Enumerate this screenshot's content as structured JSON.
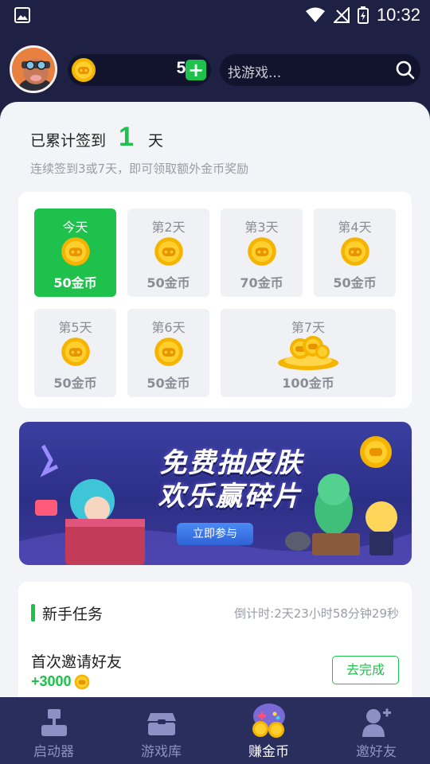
{
  "status_bar": {
    "time": "10:32"
  },
  "header": {
    "coin_count": "50",
    "add_symbol": "+",
    "search_placeholder": "找游戏..."
  },
  "checkin": {
    "title_prefix": "已累计签到",
    "days_count": "1",
    "title_suffix": "天",
    "subtitle": "连续签到3或7天，即可领取额外金币奖励",
    "days": [
      {
        "label": "今天",
        "reward": "50金币",
        "active": true
      },
      {
        "label": "第2天",
        "reward": "50金币"
      },
      {
        "label": "第3天",
        "reward": "70金币"
      },
      {
        "label": "第4天",
        "reward": "50金币"
      },
      {
        "label": "第5天",
        "reward": "50金币"
      },
      {
        "label": "第6天",
        "reward": "50金币"
      },
      {
        "label": "第7天",
        "reward": "100金币"
      }
    ]
  },
  "banner": {
    "line1": "免费抽皮肤",
    "line2": "欢乐赢碎片",
    "button": "立即参与"
  },
  "tasks": {
    "title": "新手任务",
    "countdown": "倒计时:2天23小时58分钟29秒",
    "items": [
      {
        "name": "首次邀请好友",
        "reward": "+3000",
        "button": "去完成"
      }
    ]
  },
  "bottom_nav": [
    {
      "label": "启动器",
      "icon": "launcher-icon"
    },
    {
      "label": "游戏库",
      "icon": "game-library-icon"
    },
    {
      "label": "赚金币",
      "icon": "earn-coins-icon",
      "active": true
    },
    {
      "label": "邀好友",
      "icon": "invite-friend-icon"
    }
  ],
  "colors": {
    "background": "#1e2144",
    "accent_green": "#1ec14b",
    "panel": "#f3f4f7",
    "nav": "#2a2e5c",
    "coin": "#f5b400"
  }
}
